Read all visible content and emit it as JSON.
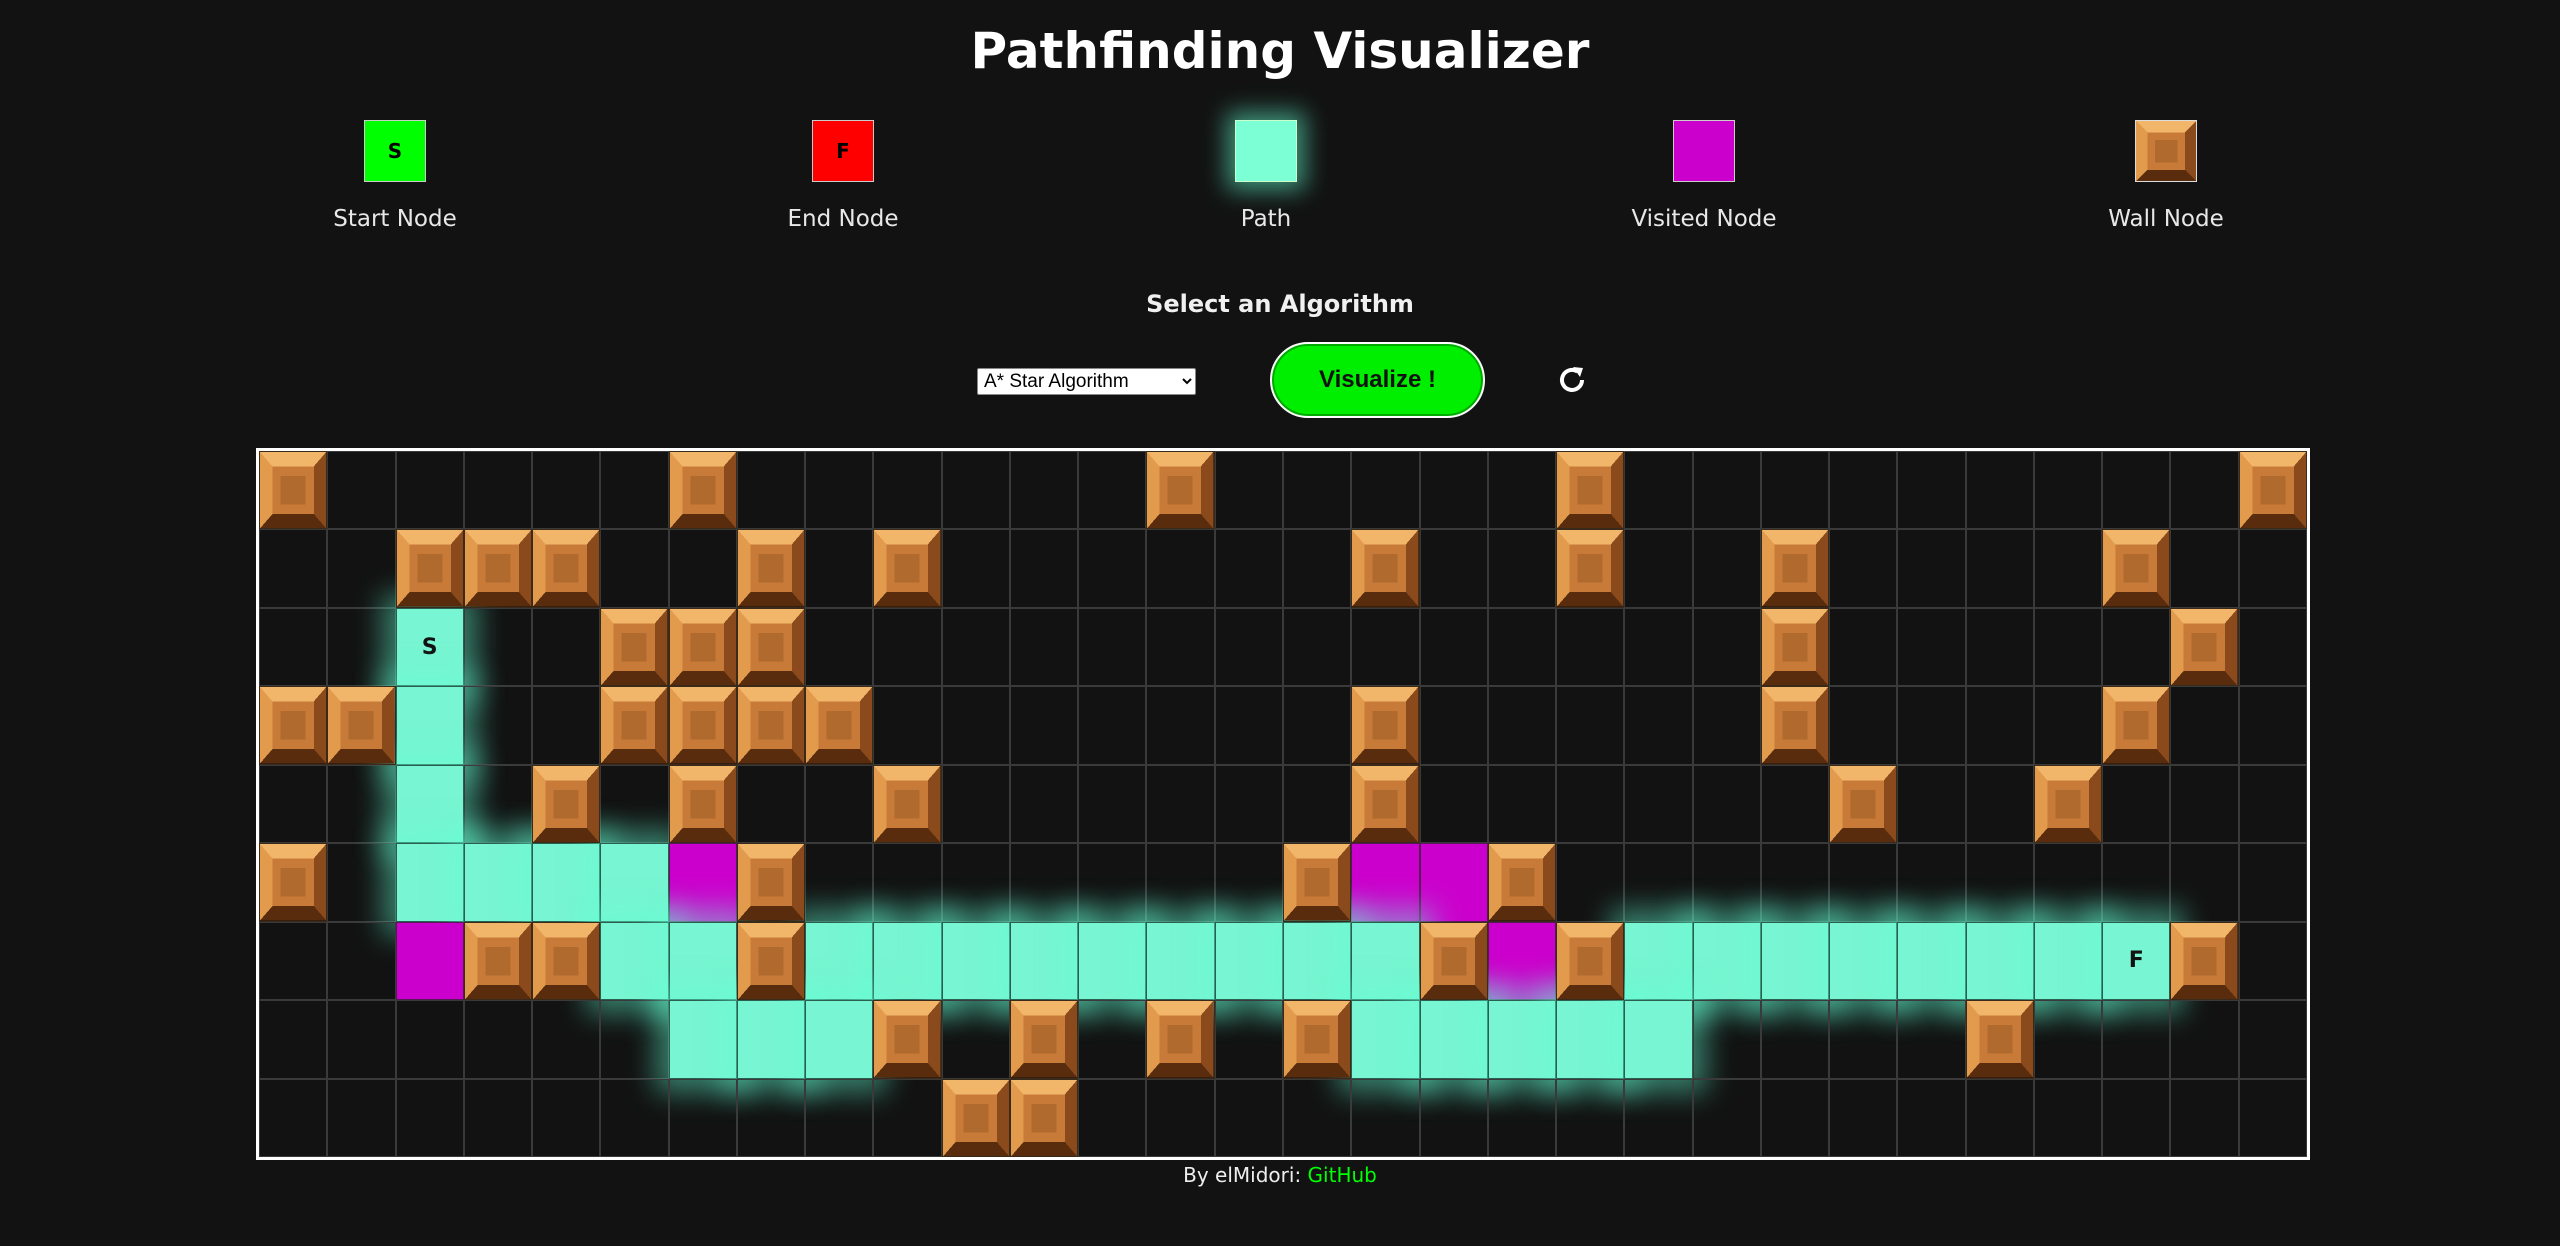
{
  "title": "Pathfinding Visualizer",
  "legend": {
    "start": {
      "label": "Start Node",
      "glyph": "S"
    },
    "end": {
      "label": "End Node",
      "glyph": "F"
    },
    "path": {
      "label": "Path"
    },
    "visited": {
      "label": "Visited Node"
    },
    "wall": {
      "label": "Wall Node"
    }
  },
  "controls": {
    "select_label": "Select an Algorithm",
    "algorithm_selected": "A* Star Algorithm",
    "visualize_label": "Visualize !",
    "reset_icon": "refresh-icon"
  },
  "grid": {
    "cols": 30,
    "rows": 9,
    "start": [
      2,
      2
    ],
    "end": [
      27,
      6
    ],
    "walls": [
      [
        0,
        0
      ],
      [
        6,
        0
      ],
      [
        13,
        0
      ],
      [
        19,
        0
      ],
      [
        29,
        0
      ],
      [
        2,
        1
      ],
      [
        3,
        1
      ],
      [
        4,
        1
      ],
      [
        7,
        1
      ],
      [
        9,
        1
      ],
      [
        16,
        1
      ],
      [
        19,
        1
      ],
      [
        22,
        1
      ],
      [
        27,
        1
      ],
      [
        5,
        2
      ],
      [
        6,
        2
      ],
      [
        7,
        2
      ],
      [
        22,
        2
      ],
      [
        28,
        2
      ],
      [
        0,
        3
      ],
      [
        1,
        3
      ],
      [
        5,
        3
      ],
      [
        6,
        3
      ],
      [
        7,
        3
      ],
      [
        8,
        3
      ],
      [
        16,
        3
      ],
      [
        22,
        3
      ],
      [
        27,
        3
      ],
      [
        4,
        4
      ],
      [
        6,
        4
      ],
      [
        9,
        4
      ],
      [
        16,
        4
      ],
      [
        23,
        4
      ],
      [
        26,
        4
      ],
      [
        0,
        5
      ],
      [
        7,
        5
      ],
      [
        15,
        5
      ],
      [
        18,
        5
      ],
      [
        3,
        6
      ],
      [
        4,
        6
      ],
      [
        7,
        6
      ],
      [
        17,
        6
      ],
      [
        19,
        6
      ],
      [
        28,
        6
      ],
      [
        9,
        7
      ],
      [
        11,
        7
      ],
      [
        13,
        7
      ],
      [
        15,
        7
      ],
      [
        25,
        7
      ],
      [
        10,
        8
      ],
      [
        11,
        8
      ]
    ],
    "visited": [
      [
        6,
        5
      ],
      [
        16,
        5
      ],
      [
        17,
        5
      ],
      [
        2,
        6
      ],
      [
        18,
        6
      ]
    ],
    "path": [
      [
        2,
        3
      ],
      [
        2,
        4
      ],
      [
        2,
        5
      ],
      [
        3,
        5
      ],
      [
        4,
        5
      ],
      [
        5,
        5
      ],
      [
        5,
        6
      ],
      [
        6,
        6
      ],
      [
        8,
        6
      ],
      [
        9,
        6
      ],
      [
        10,
        6
      ],
      [
        11,
        6
      ],
      [
        12,
        6
      ],
      [
        13,
        6
      ],
      [
        14,
        6
      ],
      [
        15,
        6
      ],
      [
        16,
        6
      ],
      [
        20,
        6
      ],
      [
        21,
        6
      ],
      [
        22,
        6
      ],
      [
        23,
        6
      ],
      [
        24,
        6
      ],
      [
        25,
        6
      ],
      [
        26,
        6
      ],
      [
        6,
        7
      ],
      [
        7,
        7
      ],
      [
        8,
        7
      ],
      [
        16,
        7
      ],
      [
        17,
        7
      ],
      [
        18,
        7
      ],
      [
        19,
        7
      ],
      [
        20,
        7
      ]
    ]
  },
  "footer": {
    "text": "By elMidori: ",
    "link": "GitHub"
  },
  "colors": {
    "start": "#00ff00",
    "end": "#ff0000",
    "path": "#78f5d2",
    "visited": "#cc00cc",
    "button": "#00ee00"
  }
}
